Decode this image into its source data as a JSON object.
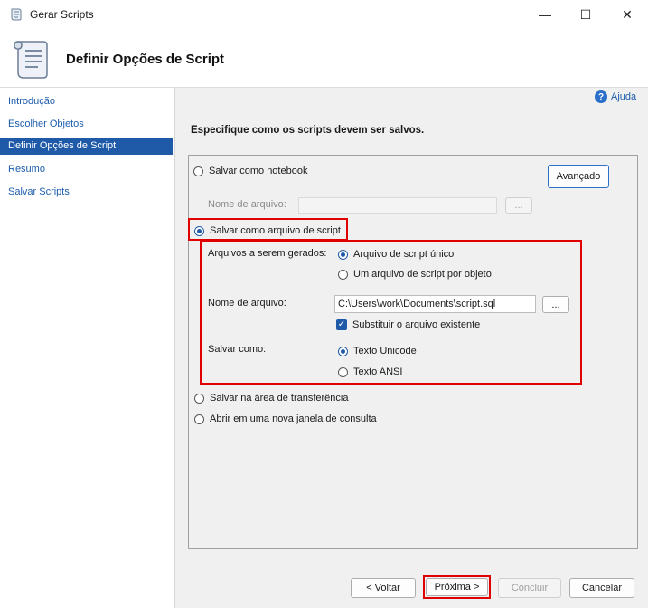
{
  "window": {
    "title": "Gerar Scripts",
    "controls": {
      "minimize": "—",
      "maximize": "☐",
      "close": "✕"
    }
  },
  "header": {
    "title": "Definir Opções de Script",
    "icon": "script-scroll-icon"
  },
  "sidebar": {
    "items": [
      {
        "label": "Introdução",
        "selected": false
      },
      {
        "label": "Escolher Objetos",
        "selected": false
      },
      {
        "label": "Definir Opções de Script",
        "selected": true
      },
      {
        "label": "Resumo",
        "selected": false
      },
      {
        "label": "Salvar Scripts",
        "selected": false
      }
    ]
  },
  "help": {
    "label": "Ajuda",
    "icon_glyph": "?"
  },
  "instruction": "Especifique como os scripts devem ser salvos.",
  "options": {
    "notebook": {
      "label": "Salvar como notebook",
      "selected": false
    },
    "advanced_button": "Avançado",
    "notebook_file_label": "Nome de arquivo:",
    "notebook_file_value": "",
    "notebook_browse": "...",
    "script_file": {
      "label": "Salvar como arquivo de script",
      "selected": true
    },
    "files_generated_label": "Arquivos a serem gerados:",
    "single_file": {
      "label": "Arquivo de script único",
      "selected": true
    },
    "per_object": {
      "label": "Um arquivo de script por objeto",
      "selected": false
    },
    "file_name_label": "Nome de arquivo:",
    "file_name_value": "C:\\Users\\work\\Documents\\script.sql",
    "browse": "...",
    "overwrite": {
      "label": "Substituir o arquivo existente",
      "checked": true
    },
    "save_as_label": "Salvar como:",
    "unicode": {
      "label": "Texto Unicode",
      "selected": true
    },
    "ansi": {
      "label": "Texto ANSI",
      "selected": false
    },
    "clipboard": {
      "label": "Salvar na área de transferência",
      "selected": false
    },
    "query_window": {
      "label": "Abrir em uma nova janela de consulta",
      "selected": false
    }
  },
  "footer": {
    "back": "< Voltar",
    "next": "Próxima >",
    "finish": "Concluir",
    "cancel": "Cancelar"
  },
  "colors": {
    "accent": "#1f5aa8",
    "highlight_box": "#e00000"
  }
}
